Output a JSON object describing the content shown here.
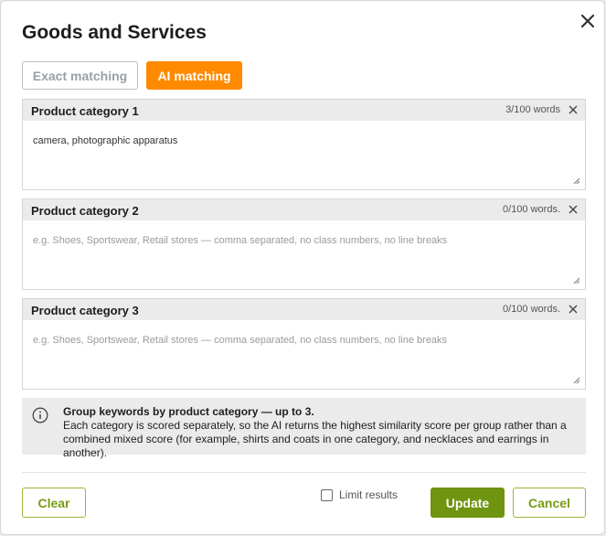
{
  "dialog": {
    "title": "Goods and Services"
  },
  "tabs": [
    {
      "label": "Exact matching",
      "active": false
    },
    {
      "label": "AI matching",
      "active": true
    }
  ],
  "categories": [
    {
      "label": "Product category 1",
      "count": "3/100 words",
      "value": "camera, photographic apparatus",
      "placeholder": ""
    },
    {
      "label": "Product category 2",
      "count": "0/100 words.",
      "value": "",
      "placeholder": "e.g. Shoes, Sportswear, Retail stores — comma separated, no class numbers, no line breaks"
    },
    {
      "label": "Product category 3",
      "count": "0/100 words.",
      "value": "",
      "placeholder": "e.g. Shoes, Sportswear, Retail stores — comma separated, no class numbers, no line breaks"
    }
  ],
  "info": {
    "title": "Group keywords by product category — up to 3.",
    "body": "Each category is scored separately, so the AI returns the highest similarity score per group rather than a combined mixed score (for example, shirts and coats in one category, and necklaces and earrings in another)."
  },
  "footer": {
    "clear_label": "Clear",
    "limit_label": "Limit results",
    "limit_checked": false,
    "update_label": "Update",
    "cancel_label": "Cancel"
  },
  "colors": {
    "accent_orange": "#ff8a00",
    "accent_green": "#6f9410",
    "outline_green": "#7a9a14"
  },
  "icons": {
    "close": "close-icon",
    "field_clear": "close-icon",
    "info": "info-circle-icon",
    "resize": "resize-grip-icon"
  }
}
